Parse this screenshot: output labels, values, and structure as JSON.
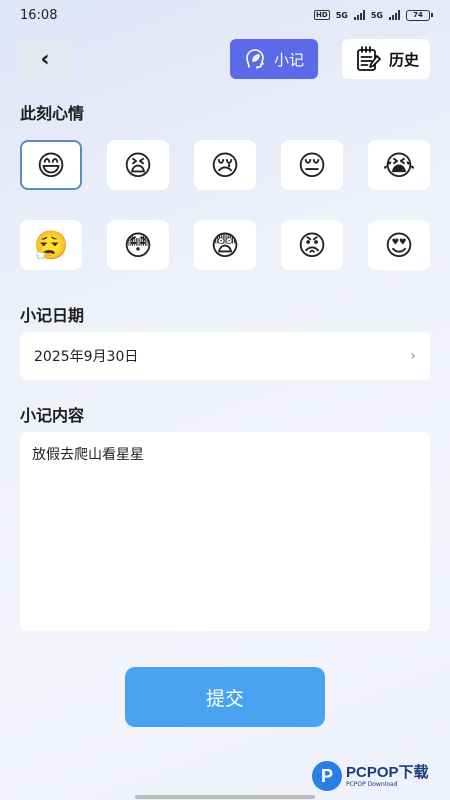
{
  "status_bar": {
    "time": "16:08",
    "hd": "HD",
    "net1": "5G",
    "net2": "5G",
    "battery": "74"
  },
  "header": {
    "back_glyph": "‹",
    "note_label": "小记",
    "note_icon": "leaf-head-icon",
    "history_label": "历史",
    "history_icon": "notepad-icon",
    "accent_color": "#5b6ae8"
  },
  "mood_section": {
    "title": "此刻心情",
    "moods": [
      "😄",
      "😫",
      "😢",
      "😔",
      "😭",
      "😮‍💨",
      "😳",
      "😨",
      "😡",
      "😍"
    ],
    "selected_index": 0
  },
  "date_section": {
    "title": "小记日期",
    "value": "2025年9月30日",
    "chevron": "›"
  },
  "content_section": {
    "title": "小记内容",
    "value": "放假去爬山看星星"
  },
  "submit": {
    "label": "提交",
    "color": "#4aa3ee"
  },
  "watermark": {
    "logo_letter": "P",
    "main": "PCPOP下载",
    "sub": "PCPOP Download"
  }
}
